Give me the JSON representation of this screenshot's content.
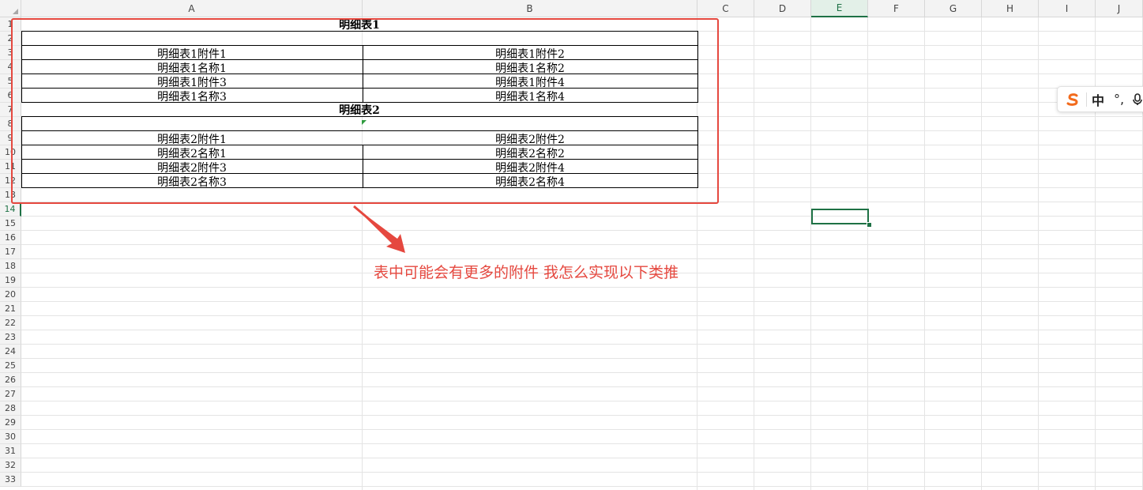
{
  "sheet": {
    "columns": [
      {
        "label": "A",
        "selected": false
      },
      {
        "label": "B",
        "selected": false
      },
      {
        "label": "C",
        "selected": false
      },
      {
        "label": "D",
        "selected": false
      },
      {
        "label": "E",
        "selected": true
      },
      {
        "label": "F",
        "selected": false
      },
      {
        "label": "G",
        "selected": false
      },
      {
        "label": "H",
        "selected": false
      },
      {
        "label": "I",
        "selected": false
      },
      {
        "label": "J",
        "selected": false
      }
    ],
    "rows": [
      "1",
      "2",
      "3",
      "4",
      "5",
      "6",
      "7",
      "8",
      "9",
      "10",
      "11",
      "12",
      "13",
      "14",
      "15",
      "16",
      "17",
      "18",
      "19",
      "20",
      "21",
      "22",
      "23",
      "24",
      "25",
      "26",
      "27",
      "28",
      "29",
      "30",
      "31",
      "32",
      "33"
    ],
    "selected_row": "14",
    "active_cell": "E14"
  },
  "table1": {
    "title": "明细表1",
    "cells": [
      [
        "明细表1附件1",
        "明细表1附件2"
      ],
      [
        "明细表1名称1",
        "明细表1名称2"
      ],
      [
        "明细表1附件3",
        "明细表1附件4"
      ],
      [
        "明细表1名称3",
        "明细表1名称4"
      ]
    ]
  },
  "table2": {
    "title": "明细表2",
    "cells": [
      [
        "明细表2附件1",
        "明细表2附件2"
      ],
      [
        "明细表2名称1",
        "明细表2名称2"
      ],
      [
        "明细表2附件3",
        "明细表2附件4"
      ],
      [
        "明细表2名称3",
        "明细表2名称4"
      ]
    ]
  },
  "annotation": {
    "text": "表中可能会有更多的附件 我怎么实现以下类推",
    "color": "#e5483f"
  },
  "ime_toolbar": {
    "logo_icon": "sogou-s-icon",
    "mode_label": "中",
    "punct_label": "°,",
    "mic_icon": "microphone-icon"
  },
  "colors": {
    "accent": "#1e7145",
    "header_bg": "#f3f3f3",
    "annotation_red": "#e5483f"
  }
}
